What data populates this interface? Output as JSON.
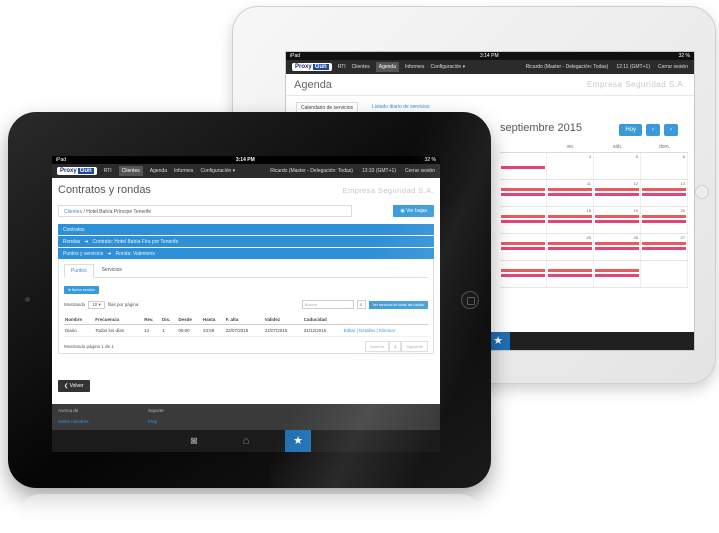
{
  "back_tablet": {
    "status": {
      "carrier": "iPad",
      "time": "3:14 PM",
      "battery": "32 %"
    },
    "nav": {
      "brand": "Proxy",
      "brand_mark": "Gun",
      "items": [
        "RTI",
        "Clientes",
        "Agenda",
        "Informes",
        "Configuración ▾"
      ],
      "active": "Agenda",
      "user": "Ricardo (Master - Delegación: Todas)",
      "clock": "12:11 (GMT+1)",
      "logout": "Cerrar sesión"
    },
    "title": "Agenda",
    "company": "Empresa Seguridad S.A.",
    "tabs": [
      "Calendario de servicios",
      "Listado diario de servicios"
    ],
    "calendar": {
      "month": "septiembre 2015",
      "today_button": "Hoy",
      "prev": "‹",
      "next": "›",
      "dow": [
        "vie.",
        "sáb.",
        "dom."
      ],
      "weeks": [
        [
          "4",
          "5",
          "6"
        ],
        [
          "11",
          "12",
          "13"
        ],
        [
          "18",
          "19",
          "20"
        ],
        [
          "25",
          "26",
          "27"
        ]
      ]
    }
  },
  "front_tablet": {
    "status": {
      "carrier": "iPad",
      "time": "3:14 PM",
      "battery": "32 %"
    },
    "nav": {
      "brand": "Proxy",
      "brand_mark": "Gun",
      "items": [
        "RTI",
        "Clientes",
        "Agenda",
        "Informes",
        "Configuración ▾"
      ],
      "active": "Clientes",
      "user": "Ricardo (Master - Delegación: Todas)",
      "clock": "13:33 (GMT+1)",
      "logout": "Cerrar sesión"
    },
    "title": "Contratos y rondas",
    "company": "Empresa Seguridad S.A.",
    "breadcrumb": {
      "link": "Clientes",
      "current": "Hotel Bahía Príncipe Tenerife"
    },
    "ver_bajas": "Ver bajas",
    "bars": {
      "contratos": "Contratos",
      "rondas": "Rondas",
      "rondas_detail": "Contrato: Hotel Bahía Fira por Tenerife",
      "puntos": "Puntos y servicios",
      "puntos_detail": "Ronda: Valentens"
    },
    "tabs": {
      "puntos": "Puntos",
      "servicios": "Servicios"
    },
    "nuevo_servicio": "Nuevo servicio",
    "show": {
      "prefix": "Mostrando",
      "value": "10",
      "suffix": "filas por página"
    },
    "search_placeholder": "Buscar",
    "ver_servicios": "Ver servicios de todas las rondas",
    "table": {
      "headers": [
        "Nombre",
        "Frecuencia",
        "Rev.",
        "Dis.",
        "Desde",
        "Hasta",
        "F. alta",
        "Validez",
        "Caducidad",
        ""
      ],
      "rows": [
        {
          "nombre": "Diario",
          "frecuencia": "Todos los días",
          "rev": "12",
          "dis": "1",
          "desde": "00:00",
          "hasta": "23:59",
          "alta": "22/07/2015",
          "validez": "22/07/2015",
          "caducidad": "31/12/2015",
          "acciones": "Editar | Detalles | Eliminar"
        }
      ]
    },
    "pagination": {
      "info": "Mostrando página 1 de 1",
      "prev": "Anterior",
      "page": "1",
      "next": "Siguiente"
    },
    "volver": "Volver",
    "footer": {
      "col1_title": "Acerca de",
      "col1_link": "Sobre nosotros",
      "col2_title": "Soporte",
      "col2_link": "FAQ"
    }
  },
  "icons": [
    "camera-icon",
    "home-icon",
    "star-icon",
    "back-arrow-icon",
    "search-icon",
    "eye-icon"
  ],
  "colors": {
    "accent": "#2d8fd6",
    "nav": "#2b2b2b",
    "event_red": "#e65c5c",
    "event_pink": "#e3457a",
    "star_tab": "#1f6fb3"
  }
}
